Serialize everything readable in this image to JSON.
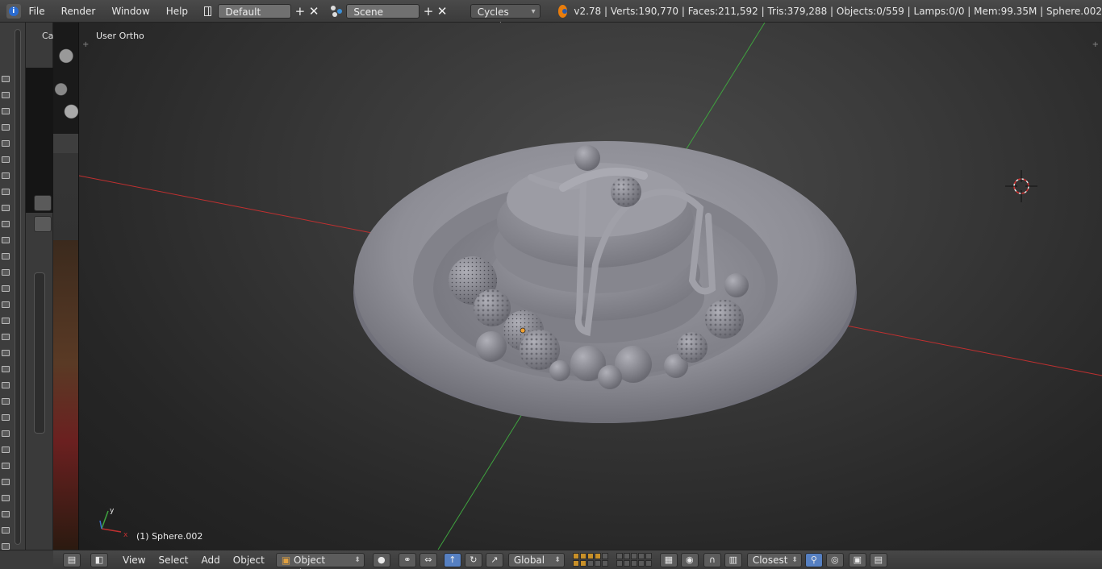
{
  "topbar": {
    "menus": [
      "File",
      "Render",
      "Window",
      "Help"
    ],
    "screen_layout": "Default",
    "scene": "Scene",
    "render_engine": "Cycles Render",
    "stats": "v2.78 | Verts:190,770 | Faces:211,592 | Tris:379,288 | Objects:0/559 | Lamps:0/0 | Mem:99.35M | Sphere.002"
  },
  "left_panel": {
    "label": "Ca"
  },
  "viewport": {
    "view_label": "User Ortho",
    "object_label": "(1) Sphere.002",
    "axis_x": "x",
    "axis_y": "y",
    "background_color": "#393939",
    "model_color": "#8c8c94"
  },
  "bottombar": {
    "menus": [
      "View",
      "Select",
      "Add",
      "Object"
    ],
    "mode": "Object Mode",
    "orientation": "Global",
    "snap_target": "Closest"
  },
  "colors": {
    "x_axis": "#c03030",
    "y_axis": "#3fa33f",
    "accent": "#5680c2",
    "layer_active": "#c89028"
  }
}
